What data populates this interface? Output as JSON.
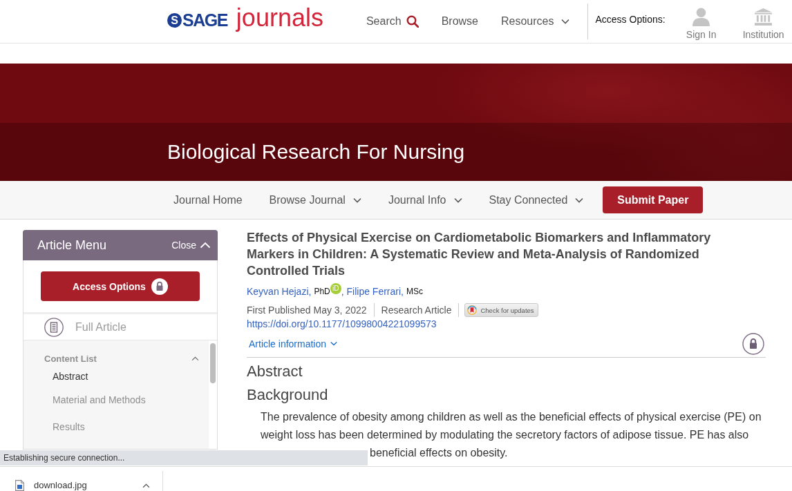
{
  "header": {
    "logo": {
      "mark": "S",
      "brand": "SAGE",
      "product": "journals"
    },
    "nav": [
      {
        "label": "Search",
        "kind": "search"
      },
      {
        "label": "Browse",
        "kind": "link"
      },
      {
        "label": "Resources",
        "kind": "dropdown"
      }
    ],
    "access_label": "Access Options:",
    "access_items": [
      {
        "label": "Sign In",
        "kind": "user"
      },
      {
        "label": "Institution",
        "kind": "institution"
      }
    ]
  },
  "banner": {
    "title": "Biological Research For Nursing"
  },
  "journal_nav": {
    "items": [
      {
        "label": "Journal Home",
        "kind": "link"
      },
      {
        "label": "Browse Journal",
        "kind": "dropdown"
      },
      {
        "label": "Journal Info",
        "kind": "dropdown"
      },
      {
        "label": "Stay Connected",
        "kind": "dropdown"
      }
    ],
    "submit_button": "Submit Paper"
  },
  "article_menu": {
    "title": "Article Menu",
    "close_label": "Close",
    "access_button": "Access Options",
    "full_article": "Full Article",
    "content_list": {
      "title": "Content List",
      "expanded": true,
      "items": [
        {
          "label": "Abstract",
          "selected": true
        },
        {
          "label": "Material and Methods",
          "selected": false
        },
        {
          "label": "Results",
          "selected": false
        }
      ]
    }
  },
  "article": {
    "title": "Effects of Physical Exercise on Cardiometabolic Biomarkers and Inflammatory Markers in Children: A Systematic Review and Meta-Analysis of Randomized Controlled Trials",
    "authors": [
      {
        "name": "Keyvan Hejazi,",
        "degree": "PhD",
        "badge": "iD"
      },
      {
        "name": ", Filipe Ferrari,",
        "degree": "MSc"
      }
    ],
    "meta": [
      {
        "kind": "text",
        "text": "First Published May 3, 2022"
      },
      {
        "kind": "text",
        "text": "Research Article"
      },
      {
        "kind": "badge",
        "text": "Check for updates"
      }
    ],
    "doi": "https://doi.org/10.1177/10998004221099573",
    "info_toggle": {
      "label": "Article information",
      "expanded": false
    },
    "sections": [
      {
        "kind": "heading",
        "text": "Abstract"
      },
      {
        "kind": "subheading",
        "text": "Background"
      },
      {
        "kind": "paragraph",
        "text": "The prevalence of obesity among children as well as the beneficial effects of physical exercise (PE) on weight loss has been determined by modulating the secretory factors of adipose tissue. PE has also"
      },
      {
        "kind": "continuation",
        "text": "beneficial effects on obesity."
      }
    ]
  },
  "status_bubble": "Establishing secure connection...",
  "downloads": [
    {
      "filename": "download.jpg"
    }
  ]
}
